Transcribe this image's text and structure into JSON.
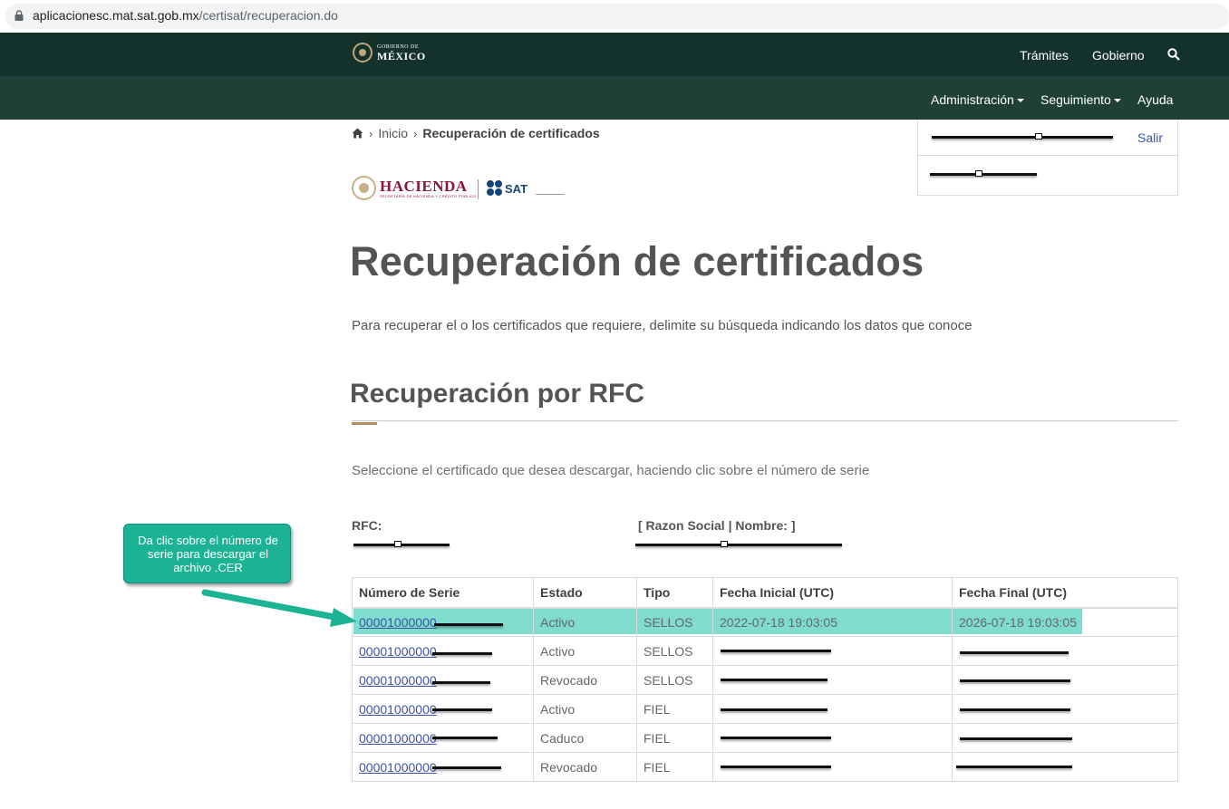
{
  "browser": {
    "url_host": "aplicacionesc.mat.sat.gob.mx",
    "url_path": "/certisat/recuperacion.do"
  },
  "gov_header": {
    "logo_line1": "GOBIERNO DE",
    "logo_line2": "MÉXICO",
    "nav_tramites": "Trámites",
    "nav_gobierno": "Gobierno",
    "sub_administracion": "Administración",
    "sub_seguimiento": "Seguimiento",
    "sub_ayuda": "Ayuda"
  },
  "user_panel": {
    "logout_label": "Salir"
  },
  "breadcrumb": {
    "home": "Inicio",
    "current": "Recuperación de certificados"
  },
  "logos": {
    "hacienda": "HACIENDA",
    "hacienda_sub": "SECRETARÍA DE HACIENDA Y CRÉDITO PÚBLICO",
    "sat": "SAT"
  },
  "page": {
    "title": "Recuperación de certificados",
    "intro": "Para recuperar el o los certificados que requiere, delimite su búsqueda indicando los datos que conoce",
    "section_title": "Recuperación por RFC",
    "instruction": "Seleccione el certificado que desea descargar, haciendo clic sobre el número de serie",
    "rfc_label": "RFC:",
    "razon_label": "[ Razon Social | Nombre: ]"
  },
  "table": {
    "headers": [
      "Número de Serie",
      "Estado",
      "Tipo",
      "Fecha Inicial (UTC)",
      "Fecha Final (UTC)"
    ],
    "rows": [
      {
        "serie": "00001000000",
        "estado": "Activo",
        "tipo": "SELLOS",
        "inicio": "2022-07-18 19:03:05",
        "fin": "2026-07-18 19:03:05"
      },
      {
        "serie": "00001000000",
        "estado": "Activo",
        "tipo": "SELLOS",
        "inicio": "",
        "fin": ""
      },
      {
        "serie": "00001000000",
        "estado": "Revocado",
        "tipo": "SELLOS",
        "inicio": "",
        "fin": ""
      },
      {
        "serie": "00001000000",
        "estado": "Activo",
        "tipo": "FIEL",
        "inicio": "",
        "fin": ""
      },
      {
        "serie": "00001000000",
        "estado": "Caduco",
        "tipo": "FIEL",
        "inicio": "",
        "fin": ""
      },
      {
        "serie": "00001000000",
        "estado": "Revocado",
        "tipo": "FIEL",
        "inicio": "",
        "fin": ""
      }
    ]
  },
  "callout": {
    "text": "Da clic sobre el número de serie para descargar el archivo .CER"
  },
  "colors": {
    "header_dark": "#13322b",
    "header_sub": "#1f4036",
    "accent_gold": "#b38e5d",
    "link_blue": "#3a55a5",
    "highlight": "#7fdcce",
    "callout": "#1cb394"
  }
}
